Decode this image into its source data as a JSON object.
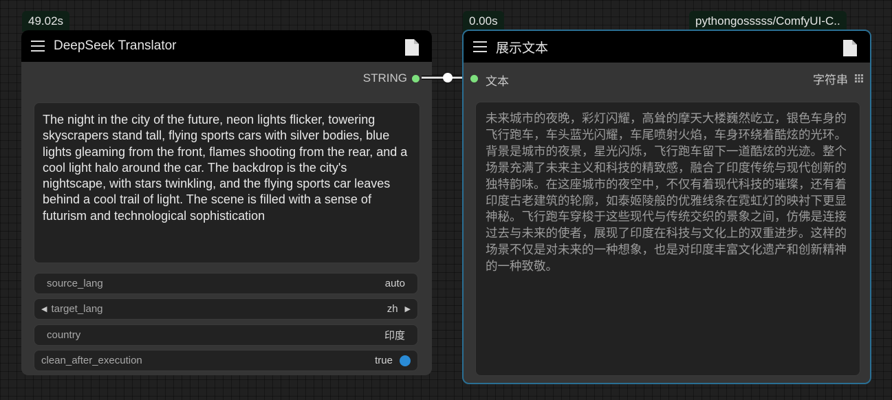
{
  "node1": {
    "time": "49.02s",
    "title": "DeepSeek Translator",
    "output_label": "STRING",
    "text": "The night in the city of the future, neon lights flicker, towering skyscrapers stand tall, flying sports cars with silver bodies, blue lights gleaming from the front, flames shooting from the rear, and a cool light halo around the car. The backdrop is the city's nightscape, with stars twinkling, and the flying sports car leaves behind a cool trail of light. The scene is filled with a sense of futurism and technological sophistication",
    "widgets": [
      {
        "label": "source_lang",
        "value": "auto"
      },
      {
        "label": "target_lang",
        "value": "zh"
      },
      {
        "label": "country",
        "value": "印度"
      },
      {
        "label": "clean_after_execution",
        "value": "true"
      }
    ]
  },
  "node2": {
    "time": "0.00s",
    "source": "pythongosssss/ComfyUI-C..",
    "title": "展示文本",
    "input_label": "文本",
    "output_label": "字符串",
    "text": "未来城市的夜晚，彩灯闪耀，高耸的摩天大楼巍然屹立，银色车身的飞行跑车，车头蓝光闪耀，车尾喷射火焰，车身环绕着酷炫的光环。背景是城市的夜景，星光闪烁，飞行跑车留下一道酷炫的光迹。整个场景充满了未来主义和科技的精致感，融合了印度传统与现代创新的独特韵味。在这座城市的夜空中，不仅有着现代科技的璀璨，还有着印度古老建筑的轮廓，如泰姬陵般的优雅线条在霓虹灯的映衬下更显神秘。飞行跑车穿梭于这些现代与传统交织的景象之间，仿佛是连接过去与未来的使者，展现了印度在科技与文化上的双重进步。这样的场景不仅是对未来的一种想象，也是对印度丰富文化遗产和创新精神的一种致敬。"
  },
  "colors": {
    "accent_border": "#2a6f94",
    "port_dot": "#7ee07e",
    "toggle": "#2a8bd6"
  }
}
